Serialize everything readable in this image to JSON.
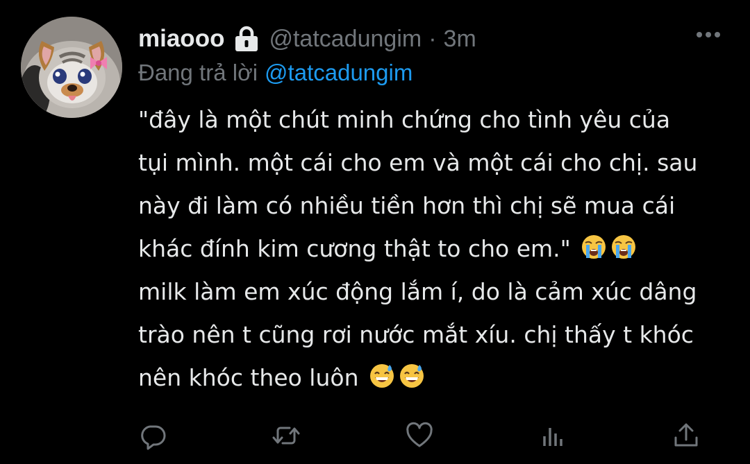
{
  "tweet": {
    "display_name": "miaooo",
    "handle": "@tatcadungim",
    "separator": "·",
    "time": "3m",
    "reply_prefix": "Đang trả lời",
    "reply_handle": "@tatcadungim",
    "text_lines": [
      "\"đây là một chút minh chứng cho tình yêu của",
      "tụi mình. một cái cho em và một cái cho chị. sau",
      "này đi làm có nhiều tiền hơn thì chị sẽ mua cái",
      "khác đính kim cương thật to cho em.\"",
      "milk làm em xúc động lắm í, do là cảm xúc dâng",
      "trào nên t cũng rơi nước mắt xíu. chị thấy t khóc",
      "nên khóc theo luôn"
    ]
  },
  "icons": {
    "lock": "lock-icon",
    "more": "more-icon",
    "emoji_line4": [
      "loudly-crying-face-emoji",
      "loudly-crying-face-emoji"
    ],
    "emoji_line7": [
      "grinning-sweat-face-emoji",
      "grinning-sweat-face-emoji"
    ],
    "actions": [
      "reply-icon",
      "retweet-icon",
      "like-icon",
      "analytics-icon",
      "share-icon"
    ]
  },
  "colors": {
    "background": "#000000",
    "text_primary": "#e7e9ea",
    "text_secondary": "#71767b",
    "link": "#1d9bf0"
  }
}
